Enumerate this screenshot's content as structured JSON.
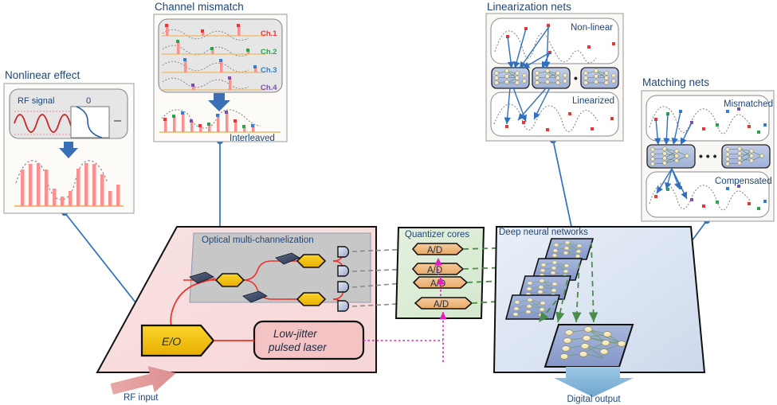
{
  "figure": {
    "title_nonlinear": "Nonlinear effect",
    "title_channel": "Channel mismatch",
    "title_linearization": "Linearization nets",
    "title_matching": "Matching nets"
  },
  "nonlinear_panel": {
    "title": "Nonlinear effect",
    "rf_label": "RF signal",
    "zero_label": "0",
    "minus_label": "–",
    "arrow": "down-arrow-blue",
    "output_caption": ""
  },
  "channel_panel": {
    "title": "Channel mismatch",
    "channels": [
      {
        "label": "Ch.1",
        "color": "#ee3333"
      },
      {
        "label": "Ch.2",
        "color": "#22a84a"
      },
      {
        "label": "Ch.3",
        "color": "#2f7fd4"
      },
      {
        "label": "Ch.4",
        "color": "#7a4fb0"
      }
    ],
    "interleaved_label": "Interleaved",
    "arrow": "down-arrow-blue"
  },
  "linearization_panel": {
    "title": "Linearization nets",
    "top_label": "Non-linear",
    "bottom_label": "Linearized",
    "ellipsis": "• • •",
    "net_block_count": 3
  },
  "matching_panel": {
    "title": "Matching nets",
    "top_label": "Mismatched",
    "bottom_label": "Compensated",
    "ellipsis": "• • •",
    "net_block_count": 2
  },
  "photonic_plane": {
    "label": "Optical multi-channelization",
    "modulator_label": "E/O",
    "laser_label_line1": "Low-jitter",
    "laser_label_line2": "pulsed laser",
    "input_label": "RF input",
    "plane_color": "#f9dede",
    "inner_color": "#c9c9c9",
    "modulator_color": "#f5c400",
    "laser_color": "#f4c3c3",
    "waveguide_color": "#e8322a",
    "photodetector_count": 4
  },
  "quantizer_plane": {
    "label": "Quantizer cores",
    "adc_label": "A/D",
    "adc_count": 4,
    "plane_color": "#dcecd8",
    "adc_color": "#f0b97a",
    "clock_color": "#e020c0"
  },
  "dnn_plane": {
    "label": "Deep neural networks",
    "output_label": "Digital output",
    "net_tile_count": 4,
    "plane_color": "#dde5f2",
    "tile_color": "#94a8d4",
    "arrow_color": "#4a8c4a",
    "output_arrow_color": "#7fb4d8"
  },
  "colors": {
    "text_blue": "#1e4678",
    "connector_blue": "#2f6fc0",
    "pulse_red": "#f98a8a",
    "baseline_orange": "#f0b860",
    "envelope_gray": "#8a8a8a",
    "rf_red": "#cc2222",
    "transfer_blue": "#2a5fa8",
    "panel_bg": "#faf8f5",
    "panel_border": "#9a9a9a",
    "inner_gray": "#e8e8e8",
    "rf_arrow": "#e09494"
  },
  "connectors": [
    {
      "name": "nonlinear-to-eo",
      "from": "nonlinear-panel",
      "to": "eo-modulator"
    },
    {
      "name": "channel-to-optical",
      "from": "channel-panel",
      "to": "optical-plane"
    },
    {
      "name": "linearization-to-dnn",
      "from": "linearization-panel",
      "to": "dnn-plane"
    },
    {
      "name": "matching-to-dnn-output",
      "from": "matching-panel",
      "to": "dnn-output-tile"
    }
  ]
}
